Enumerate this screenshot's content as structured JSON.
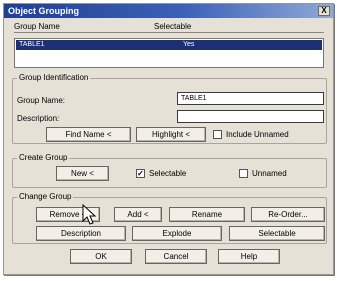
{
  "window": {
    "title": "Object Grouping",
    "close_label": "X"
  },
  "list": {
    "columns": [
      "Group Name",
      "Selectable"
    ],
    "rows": [
      {
        "name": "TABLE1",
        "selectable": "Yes"
      }
    ]
  },
  "group_identification": {
    "title": "Group Identification",
    "group_name_label": "Group Name:",
    "group_name_value": "TABLE1",
    "description_label": "Description:",
    "description_value": "",
    "find_name_button": "Find Name <",
    "highlight_button": "Highlight <",
    "include_unnamed_label": "Include Unnamed",
    "include_unnamed_checked": false
  },
  "create_group": {
    "title": "Create Group",
    "new_button": "New <",
    "selectable_label": "Selectable",
    "selectable_checked": true,
    "selectable_mark": "✓",
    "unnamed_label": "Unnamed",
    "unnamed_checked": false
  },
  "change_group": {
    "title": "Change Group",
    "remove_button": "Remove <",
    "add_button": "Add <",
    "rename_button": "Rename",
    "reorder_button": "Re-Order...",
    "description_button": "Description",
    "explode_button": "Explode",
    "selectable_button": "Selectable"
  },
  "footer": {
    "ok_button": "OK",
    "cancel_button": "Cancel",
    "help_button": "Help"
  },
  "cursor_icon": "arrow-pointer-icon"
}
